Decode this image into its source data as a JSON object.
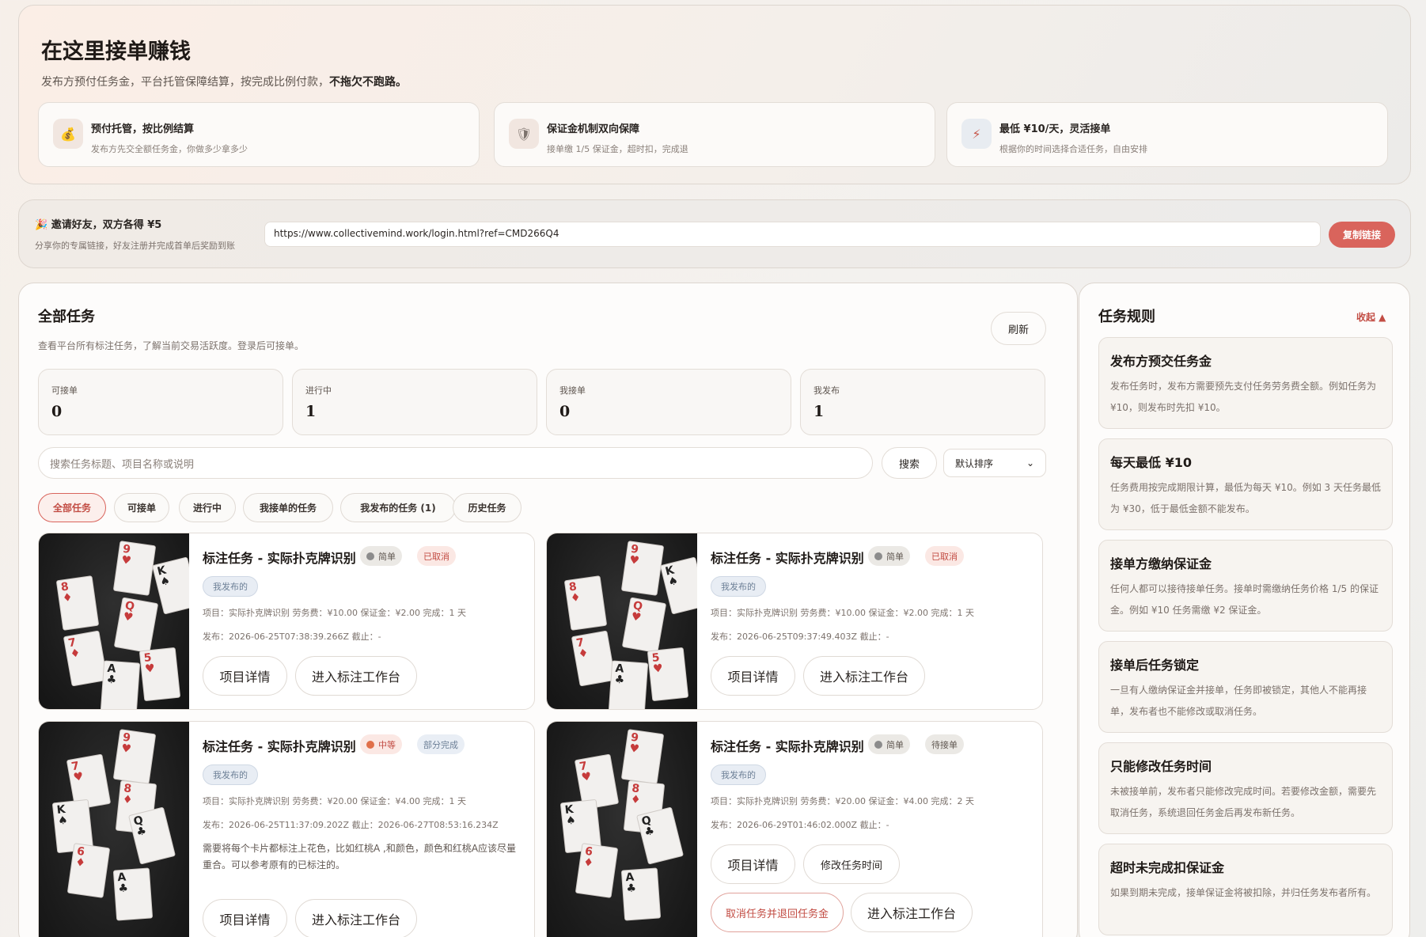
{
  "hero": {
    "title": "在这里接单赚钱",
    "subtitle": "发布方预付任务金，平台托管保障结算，按完成比例付款，",
    "subtitle_bold": "不拖欠不跑路。",
    "features": [
      {
        "icon": "money-bag-icon",
        "glyph": "💰",
        "title": "预付托管，按比例结算",
        "desc": "发布方先交全额任务金，你做多少拿多少"
      },
      {
        "icon": "shield-icon",
        "glyph": "🛡",
        "title": "保证金机制双向保障",
        "desc": "接单缴 1/5 保证金，超时扣，完成退"
      },
      {
        "icon": "lightning-icon",
        "glyph": "⚡",
        "title": "最低 ¥10/天，灵活接单",
        "desc": "根据你的时间选择合适任务，自由安排"
      }
    ]
  },
  "invite": {
    "title": "🎉 邀请好友，双方各得 ¥5",
    "desc": "分享你的专属链接，好友注册并完成首单后奖励到账",
    "link": "https://www.collectivemind.work/login.html?ref=CMD266Q4",
    "copy_label": "复制链接"
  },
  "tasks": {
    "title": "全部任务",
    "subtitle": "查看平台所有标注任务，了解当前交易活跃度。登录后可接单。",
    "refresh_label": "刷新",
    "stats": [
      {
        "label": "可接单",
        "value": "0"
      },
      {
        "label": "进行中",
        "value": "1"
      },
      {
        "label": "我接单",
        "value": "0"
      },
      {
        "label": "我发布",
        "value": "1"
      }
    ],
    "search_placeholder": "搜索任务标题、项目名称或说明",
    "search_label": "搜索",
    "sort_value": "默认排序",
    "filters": [
      "全部任务",
      "可接单",
      "进行中",
      "我接单的任务",
      "我发布的任务 (1)",
      "历史任务"
    ],
    "cards": [
      {
        "title": "标注任务 - 实际扑克牌识别",
        "difficulty": "简单",
        "status": "已取消",
        "owner_tag": "我发布的",
        "meta1": "项目：实际扑克牌识别    劳务费：¥10.00    保证金：¥2.00    完成：1 天",
        "meta2": "发布：2026-06-25T07:38:39.266Z    截止：-",
        "desc": "",
        "buttons": [
          "项目详情",
          "进入标注工作台"
        ]
      },
      {
        "title": "标注任务 - 实际扑克牌识别",
        "difficulty": "简单",
        "status": "已取消",
        "owner_tag": "我发布的",
        "meta1": "项目：实际扑克牌识别    劳务费：¥10.00    保证金：¥2.00    完成：1 天",
        "meta2": "发布：2026-06-25T09:37:49.403Z    截止：-",
        "desc": "",
        "buttons": [
          "项目详情",
          "进入标注工作台"
        ]
      },
      {
        "title": "标注任务 - 实际扑克牌识别",
        "difficulty": "中等",
        "status": "部分完成",
        "owner_tag": "我发布的",
        "meta1": "项目：实际扑克牌识别    劳务费：¥20.00    保证金：¥4.00    完成：1 天",
        "meta2": "发布：2026-06-25T11:37:09.202Z    截止：2026-06-27T08:53:16.234Z",
        "desc": "需要将每个卡片都标注上花色，比如红桃A ,和颜色，颜色和红桃A应该尽量重合。可以参考原有的已标注的。",
        "buttons": [
          "项目详情",
          "进入标注工作台"
        ]
      },
      {
        "title": "标注任务 - 实际扑克牌识别",
        "difficulty": "简单",
        "status": "待接单",
        "owner_tag": "我发布的",
        "meta1": "项目：实际扑克牌识别    劳务费：¥20.00    保证金：¥4.00    完成：2 天",
        "meta2": "发布：2026-06-29T01:46:02.000Z    截止：-",
        "desc": "",
        "buttons": [
          "项目详情",
          "修改任务时间",
          "取消任务并退回任务金",
          "进入标注工作台"
        ]
      }
    ]
  },
  "rules": {
    "title": "任务规则",
    "collapse_label": "收起 ▲",
    "items": [
      {
        "title": "发布方预交任务金",
        "desc": "发布任务时，发布方需要预先支付任务劳务费全额。例如任务为 ¥10，则发布时先扣 ¥10。"
      },
      {
        "title": "每天最低 ¥10",
        "desc": "任务费用按完成期限计算，最低为每天 ¥10。例如 3 天任务最低为 ¥30，低于最低金额不能发布。"
      },
      {
        "title": "接单方缴纳保证金",
        "desc": "任何人都可以接待接单任务。接单时需缴纳任务价格 1/5 的保证金。例如 ¥10 任务需缴 ¥2 保证金。"
      },
      {
        "title": "接单后任务锁定",
        "desc": "一旦有人缴纳保证金并接单，任务即被锁定，其他人不能再接单，发布者也不能修改或取消任务。"
      },
      {
        "title": "只能修改任务时间",
        "desc": "未被接单前，发布者只能修改完成时间。若要修改金额，需要先取消任务，系统退回任务金后再发布新任务。"
      },
      {
        "title": "超时未完成扣保证金",
        "desc": "如果到期未完成，接单保证金将被扣除，并归任务发布者所有。"
      }
    ]
  }
}
